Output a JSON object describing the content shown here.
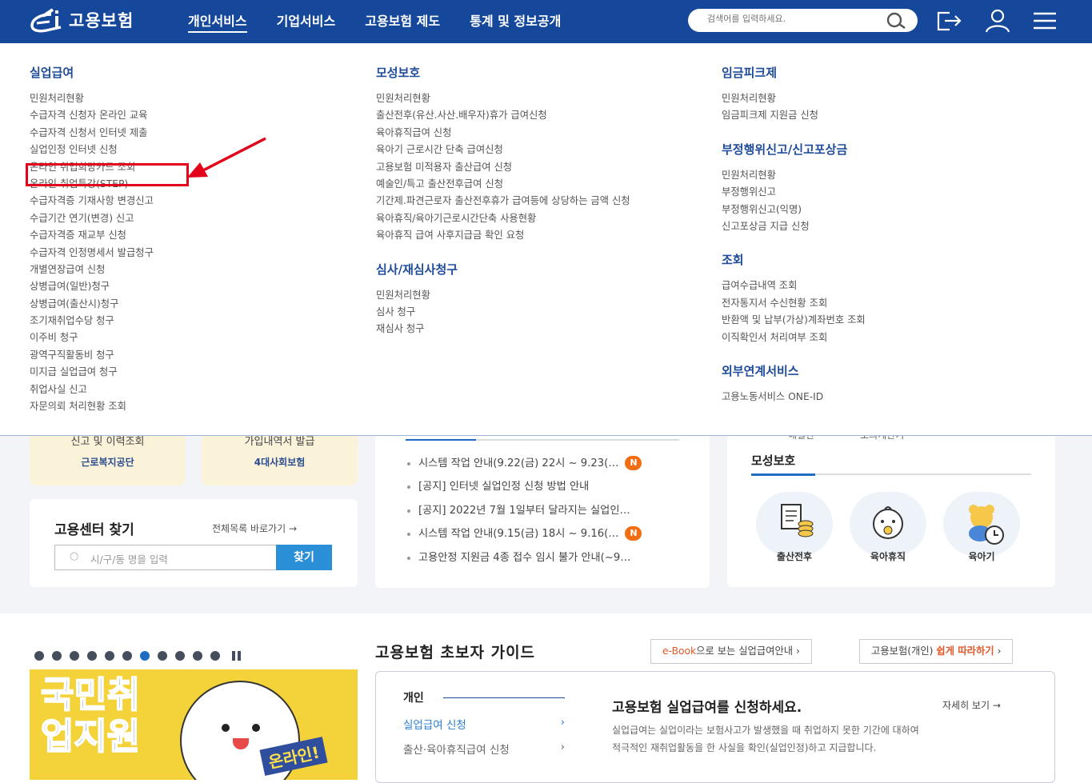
{
  "header": {
    "logo_text": "고용보험",
    "nav": [
      {
        "label": "개인서비스"
      },
      {
        "label": "기업서비스"
      },
      {
        "label": "고용보험 제도"
      },
      {
        "label": "통계 및 정보공개"
      }
    ],
    "search_placeholder": "검색어를 입력하세요."
  },
  "mega": {
    "col1": {
      "title": "실업급여",
      "items": [
        "민원처리현황",
        "수급자격 신청자 온라인 교육",
        "수급자격 신청서 인터넷 제출",
        "실업인정 인터넷 신청",
        "온라인 취업희망카드 조회",
        "온라인 취업특강(STEP)",
        "수급자격증 기재사항 변경신고",
        "수급기간 연기(변경) 신고",
        "수급자격증 재교부 신청",
        "수급자격 인정명세서 발급청구",
        "개별연장급여 신청",
        "상병급여(일반)청구",
        "상병급여(출산시)청구",
        "조기재취업수당 청구",
        "이주비 청구",
        "광역구직활동비 청구",
        "미지급 실업급여 청구",
        "취업사실 신고",
        "자문의뢰 처리현황 조회"
      ]
    },
    "col2": [
      {
        "title": "모성보호",
        "items": [
          "민원처리현황",
          "출산전후(유산.사산.배우자)휴가 급여신청",
          "육아휴직급여 신청",
          "육아기 근로시간 단축 급여신청",
          "고용보험 미적용자 출산급여 신청",
          "예술인/특고 출산전후급여 신청",
          "기간제.파견근로자 출산전후휴가 급여등에 상당하는 금액 신청",
          "육아휴직/육아기근로시간단축 사용현황",
          "육아휴직 급여 사후지급금 확인 요청"
        ]
      },
      {
        "title": "심사/재심사청구",
        "items": [
          "민원처리현황",
          "심사 청구",
          "재심사 청구"
        ]
      }
    ],
    "col3": [
      {
        "title": "임금피크제",
        "items": [
          "민원처리현황",
          "임금피크제 지원금 신청"
        ]
      },
      {
        "title": "부정행위신고/신고포상금",
        "items": [
          "민원처리현황",
          "부정행위신고",
          "부정행위신고(익명)",
          "신고포상금 지급 신청"
        ]
      },
      {
        "title": "조회",
        "items": [
          "급여수급내역 조회",
          "전자통지서 수신현황 조회",
          "반환액 및 납부(가상)계좌번호 조회",
          "이직확인서 처리여부 조회"
        ]
      },
      {
        "title": "외부연계서비스",
        "items": [
          "고용노동서비스 ONE-ID"
        ]
      }
    ]
  },
  "quick": [
    {
      "line1": "신고 및 이력조회",
      "line2": "근로복지공단"
    },
    {
      "line1": "가입내역서 발급",
      "line2": "4대사회보험"
    }
  ],
  "center": {
    "title": "고용센터 찾기",
    "all_link": "전체목록 바로가기",
    "placeholder": "시/구/동 명을 입력",
    "button": "찾기"
  },
  "notices": [
    {
      "text": "시스템 작업 안내(9.22(금) 22시 ~ 9.23(…",
      "badge": "N"
    },
    {
      "text": "[공지] 인터넷 실업인정 신청 방법 안내",
      "badge": ""
    },
    {
      "text": "[공지] 2022년 7월 1일부터 달라지는 실업인…",
      "badge": ""
    },
    {
      "text": "시스템 작업 안내(9.15(금) 18시 ~ 9.16(…",
      "badge": "N"
    },
    {
      "text": "고용안정 지원금 4종 접수 임시 불가 안내(~9…",
      "badge": ""
    }
  ],
  "right_card": {
    "top_tabs": [
      "해결안",
      "모의계산기"
    ],
    "title": "모성보호",
    "icons": [
      {
        "label": "출산전후",
        "icon": "document-coins-icon"
      },
      {
        "label": "육아휴직",
        "icon": "baby-face-icon"
      },
      {
        "label": "육아기",
        "icon": "teddy-bear-clock-icon"
      }
    ]
  },
  "guide": {
    "title": "고용보험 초보자 가이드",
    "btn1_a": "e-Book",
    "btn1_b": "으로 보는 실업급여안내",
    "btn2_a": "고용보험(개인)",
    "btn2_b": "쉽게 따라하기",
    "tab_title": "개인",
    "links": [
      "실업급여 신청",
      "출산·육아휴직급여 신청"
    ],
    "headline": "고용보험 실업급여를 신청하세요.",
    "more": "자세히 보기",
    "desc1": "실업급여는 실업이라는 보험사고가 발생했을 때 취업하지 못한 기간에 대하여",
    "desc2": "적극적인 재취업활동을 한 사실을 확인(실업인정)하고 지급합니다."
  },
  "banner": {
    "text": "국민취업지원",
    "badge": "온라인!"
  },
  "colors": {
    "header": "#15479b",
    "title": "#1f4c9a",
    "highlight": "#e2001a",
    "badge": "#f26c12"
  }
}
